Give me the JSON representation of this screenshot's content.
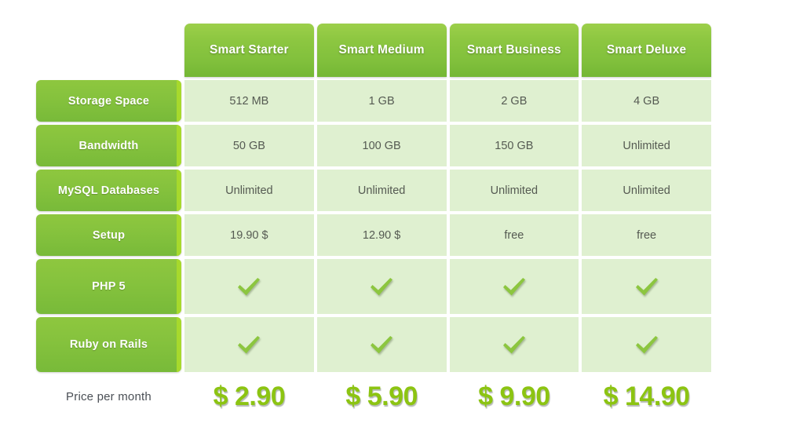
{
  "table": {
    "corner_label": "",
    "plans": [
      {
        "name": "Smart Starter"
      },
      {
        "name": "Smart Medium"
      },
      {
        "name": "Smart Business"
      },
      {
        "name": "Smart Deluxe"
      }
    ],
    "features": [
      {
        "label": "Storage Space",
        "type": "text",
        "values": [
          "512 MB",
          "1 GB",
          "2 GB",
          "4 GB"
        ]
      },
      {
        "label": "Bandwidth",
        "type": "text",
        "values": [
          "50 GB",
          "100 GB",
          "150 GB",
          "Unlimited"
        ]
      },
      {
        "label": "MySQL Databases",
        "type": "text",
        "values": [
          "Unlimited",
          "Unlimited",
          "Unlimited",
          "Unlimited"
        ]
      },
      {
        "label": "Setup",
        "type": "text",
        "values": [
          "19.90 $",
          "12.90 $",
          "free",
          "free"
        ]
      },
      {
        "label": "PHP 5",
        "type": "check",
        "values": [
          "check-icon",
          "check-icon",
          "check-icon",
          "check-icon"
        ]
      },
      {
        "label": "Ruby on Rails",
        "type": "check",
        "values": [
          "check-icon",
          "check-icon",
          "check-icon",
          "check-icon"
        ]
      }
    ],
    "price_row": {
      "label": "Price per month",
      "values": [
        "$ 2.90",
        "$ 5.90",
        "$ 9.90",
        "$ 14.90"
      ]
    }
  },
  "colors": {
    "header_green_top": "#9ccf4a",
    "header_green_bottom": "#74b735",
    "label_green": "#85c23d",
    "accent_strip": "#a7d92c",
    "cell_bg": "#dff0d0",
    "cell_text": "#555a52",
    "price_green": "#8cc412",
    "price_label_text": "#4a4f55",
    "page_bg": "#ffffff"
  }
}
